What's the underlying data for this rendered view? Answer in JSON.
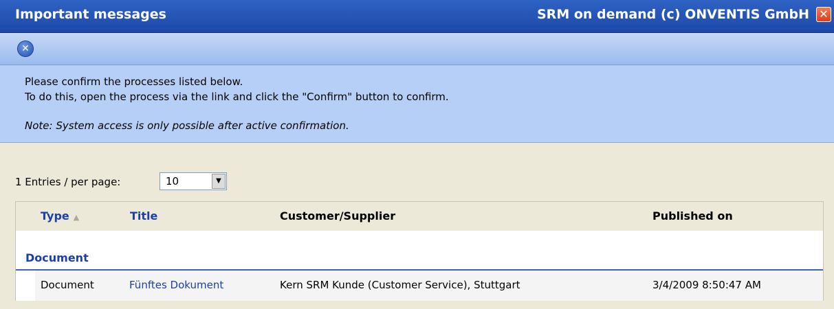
{
  "window": {
    "title": "Important messages",
    "vendor": "SRM on demand (c) ONVENTIS GmbH",
    "close_glyph": "✕"
  },
  "toolbar": {
    "close_icon_glyph": "✕"
  },
  "info": {
    "line1": "Please confirm the processes listed below.",
    "line2": "To do this, open the process via the link and click the \"Confirm\" button to confirm.",
    "note": "Note: System access is only possible after active confirmation."
  },
  "pager": {
    "label": "1 Entries / per page:",
    "page_size": "10",
    "dropdown_glyph": "▼"
  },
  "table": {
    "headers": {
      "type": "Type",
      "title": "Title",
      "customer": "Customer/Supplier",
      "published": "Published on"
    },
    "sort_glyph": "▲",
    "group": "Document",
    "rows": [
      {
        "type": "Document",
        "title": "Fünftes Dokument",
        "customer": "Kern SRM Kunde (Customer Service), Stuttgart",
        "published": "3/4/2009 8:50:47 AM"
      }
    ]
  },
  "colors": {
    "titlebar": "#2456b8",
    "link": "#1c3fa8",
    "info_bg": "#b6cff6",
    "page_bg": "#ece9d8"
  }
}
